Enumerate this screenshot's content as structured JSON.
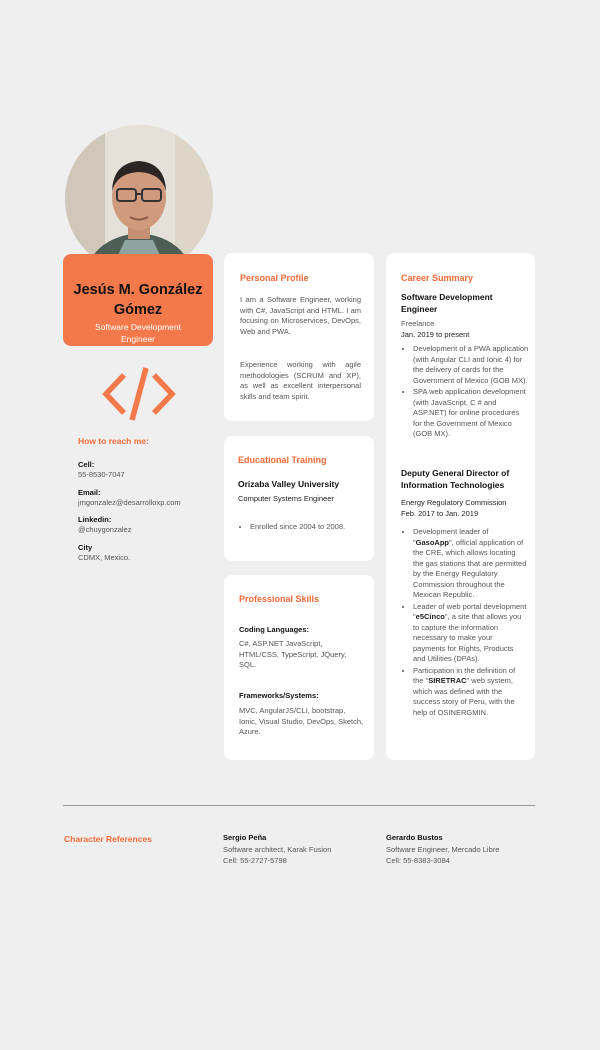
{
  "photo": {
    "alt": "Profile photo"
  },
  "name": "Jesús M. González Gómez",
  "role": "Software Development Engineer",
  "reach": {
    "heading": "How to reach me:",
    "cell_label": "Cell:",
    "cell": "55-8530-7047",
    "email_label": "Email:",
    "email": "jmgonzalez@desarrolloxp.com",
    "linkedin_label": "Linkedin:",
    "linkedin": "@chuygonzalez",
    "city_label": "City",
    "city": "CDMX, Mexico."
  },
  "profile": {
    "title": "Personal Profile",
    "p1": "I am a Software Engineer, working with C#, JavaScript and HTML. I am focusing on Microservices, DevOps, Web and PWA.",
    "p2": "Experience working with agile methodologies (SCRUM and XP), as well as excellent interpersonal skills and team spirit."
  },
  "education": {
    "title": "Educational Training",
    "school": "Orizaba Valley University",
    "degree": "Computer Systems Engineer",
    "item": "Enrolled since 2004 to 2008."
  },
  "skills": {
    "title": "Professional Skills",
    "coding_label": "Coding Languages:",
    "coding": "C#, ASP.NET JavaScript, HTML/CSS, TypeScript, JQuery, SQL.",
    "frameworks_label": "Frameworks/Systems:",
    "frameworks": "MVC, AngularJS/CLI, bootstrap, Ionic, Visual Studio, DevOps, Sketch, Azure."
  },
  "career": {
    "title": "Career Summary",
    "job1": {
      "title": "Software Development Engineer",
      "company": "Freelance",
      "dates": "Jan. 2019 to present",
      "items": [
        "Development of a PWA application (with Angular CLI and Ionic 4) for the delivery of cards for the Government of Mexico (GOB MX).",
        "SPA web application development (with JavaScript, C # and ASP.NET) for online procedures for the Government of Mexico (GOB MX)."
      ]
    },
    "job2": {
      "title": "Deputy General Director of Information Technologies",
      "company": "Energy Regulatory Commission",
      "dates": "Feb. 2017 to  Jan. 2019",
      "items": [
        {
          "pre": "Development leader of \"",
          "strong": "GasoApp",
          "post": "\", official application of the CRE, which allows locating the gas stations that are permitted by the Energy Regulatory Commission throughout the Mexican Republic."
        },
        {
          "pre": "Leader of web portal development \"",
          "strong": "e5Cinco",
          "post": "\", a site that allows you to capture the information necessary to make your payments for Rights, Products and Utilities (DPAs)."
        },
        {
          "pre": "Participation in the definition of the \"",
          "strong": "SIRETRAC",
          "post": "\" web system, which was defined with the success story of Peru, with the help of OSINERGMIN."
        }
      ]
    }
  },
  "references": {
    "title": "Character References",
    "ref1": {
      "name": "Sergio Peña",
      "position": "Software architect, Karak Fusion",
      "cell": "Cell:  55-2727-5798"
    },
    "ref2": {
      "name": "Gerardo Bustos",
      "position": "Software Engineer, Mercado Libre",
      "cell": "Cell: 55-8383-3084"
    }
  },
  "colors": {
    "accent": "#f46a37",
    "background": "#efefef",
    "card": "#ffffff"
  },
  "icons": {
    "code": "code-icon"
  }
}
